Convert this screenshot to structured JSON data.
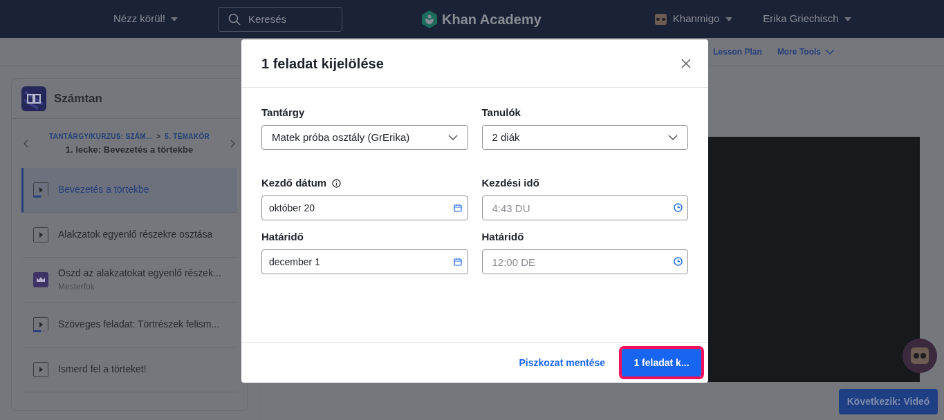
{
  "header": {
    "explore": "Nézz körül!",
    "search": {
      "placeholder": "Keresés"
    },
    "logo": "Khan Academy",
    "khanmigo": "Khanmigo",
    "user": "Erika Griechisch"
  },
  "toolbar": {
    "links": [
      "Lesson Plan",
      "More Tools"
    ]
  },
  "sidebar": {
    "title": "Számtan",
    "breadcrumb": {
      "course": "TANTÁRGY/KURZUS: SZÁM...",
      "separator": ">",
      "unit": "5. TÉMAKÖR"
    },
    "lesson": "1. lecke: Bevezetés a törtekbe",
    "items": [
      {
        "kind": "video",
        "title": "Bevezetés a törtekbe",
        "selected": true,
        "level": 0.5
      },
      {
        "kind": "video",
        "title": "Alakzatok egyenlő részekre osztása",
        "selected": false
      },
      {
        "kind": "mastery",
        "title": "Oszd az alakzatokat egyenlő részek...",
        "subtitle": "Mesterfok",
        "selected": false
      },
      {
        "kind": "video",
        "title": "Szöveges feladat: Törtrészek felism...",
        "selected": false,
        "level": 0.5
      },
      {
        "kind": "video",
        "title": "Ismerd fel a törteket!",
        "selected": false
      }
    ]
  },
  "next_button": "Következik: Videó",
  "modal": {
    "title": "1 feladat kijelölése",
    "fields": [
      {
        "kind": "select",
        "label": "Tantárgy",
        "value": "Matek próba osztály (GrErika)"
      },
      {
        "kind": "select",
        "label": "Tanulók",
        "value": "2 diák"
      },
      {
        "kind": "date",
        "label": "Kezdő dátum",
        "info": true,
        "value": "október 20"
      },
      {
        "kind": "time",
        "label": "Kezdési idő",
        "placeholder": "4:43 DU"
      },
      {
        "kind": "date",
        "label": "Határidő",
        "value": "december 1"
      },
      {
        "kind": "time",
        "label": "Határidő",
        "placeholder": "12:00 DE"
      }
    ],
    "draft_button": "Piszkozat mentése",
    "submit_button": {
      "label": "1 feladat k...",
      "focused": true
    }
  }
}
